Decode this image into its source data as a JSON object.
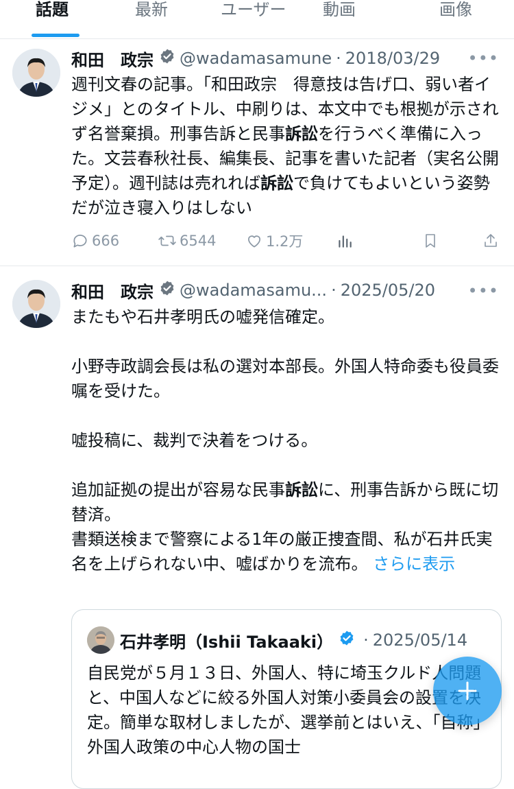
{
  "tabs": [
    {
      "label": "話題",
      "active": true
    },
    {
      "label": "最新",
      "active": false
    },
    {
      "label": "ユーザー",
      "active": false
    },
    {
      "label": "動画",
      "active": false
    },
    {
      "label": "画像",
      "active": false
    }
  ],
  "colors": {
    "accent": "#1d9bf0",
    "muted": "#536471",
    "border": "#e6e9ec"
  },
  "tweets": [
    {
      "name": "和田　政宗",
      "handle": "@wadamasamune",
      "date": "2018/03/29",
      "more_label": "•••",
      "text": {
        "seg1": "週刊文春の記事。「和田政宗　得意技は告げ口、弱い者イジメ」とのタイトル、中刷りは、本文中でも根拠が示されず名誉棄損。刑事告訴と民事",
        "kw1": "訴訟",
        "seg2": "を行うべく準備に入った。文芸春秋社長、編集長、記事を書いた記者（実名公開予定）。週刊誌は売れれば",
        "kw2": "訴訟",
        "seg3": "で負けてもよいという姿勢だが泣き寝入りはしない"
      },
      "stats": {
        "replies": "666",
        "retweets": "6544",
        "likes": "1.2万"
      }
    },
    {
      "name": "和田　政宗",
      "handle": "@wadamasamu...",
      "date": "2025/05/20",
      "more_label": "•••",
      "text": {
        "p1": "またもや石井孝明氏の嘘発信確定。",
        "p2": "小野寺政調会長は私の選対本部長。外国人特命委も役員委嘱を受けた。",
        "p3": "嘘投稿に、裁判で決着をつける。",
        "p4a": "追加証拠の提出が容易な民事",
        "p4kw": "訴訟",
        "p4b": "に、刑事告訴から既に切替済。",
        "p5": "書類送検まで警察による1年の厳正捜査間、私が石井氏実名を上げられない中、嘘ばかりを流布。",
        "show_more": "さらに表示"
      },
      "quote": {
        "name": "石井孝明（Ishii Takaaki）",
        "date": "2025/05/14",
        "text": "自民党が５月１３日、外国人、特に埼玉クルド人問題と、中国人などに絞る外国人対策小委員会の設置を決定。簡単な取材しましたが、選挙前とはいえ、「自称」外国人政策の中心人物の国士"
      }
    }
  ]
}
